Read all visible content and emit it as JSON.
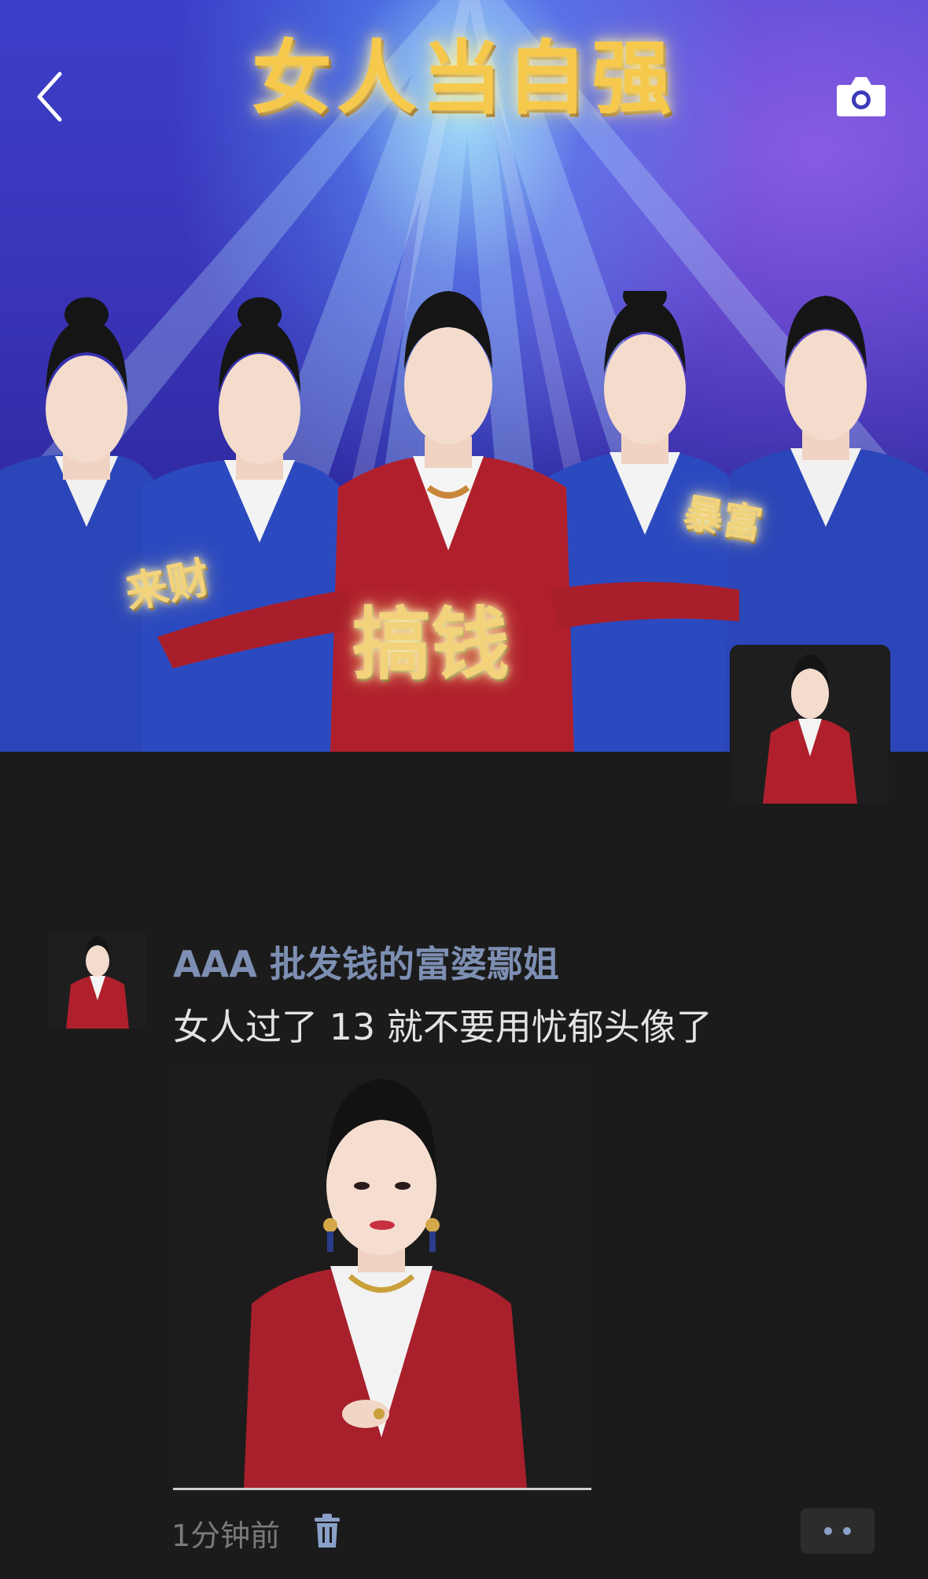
{
  "cover": {
    "title": "女人当自强",
    "stickers": {
      "left": "来财",
      "center": "搞钱",
      "right": "暴富"
    }
  },
  "post": {
    "username": "AAA 批发钱的富婆鄢姐",
    "text": "女人过了 13 就不要用忧郁头像了",
    "time": "1分钟前"
  },
  "icons": {
    "back": "chevron-left-icon",
    "camera": "camera-icon",
    "delete": "trash-icon",
    "more": "more-dots-icon"
  },
  "colors": {
    "background": "#1b1b1b",
    "username": "#7d8fb2",
    "timestamp": "#7a7a7a",
    "blazer_red": "#b0202c",
    "blazer_blue": "#2a46b8"
  }
}
